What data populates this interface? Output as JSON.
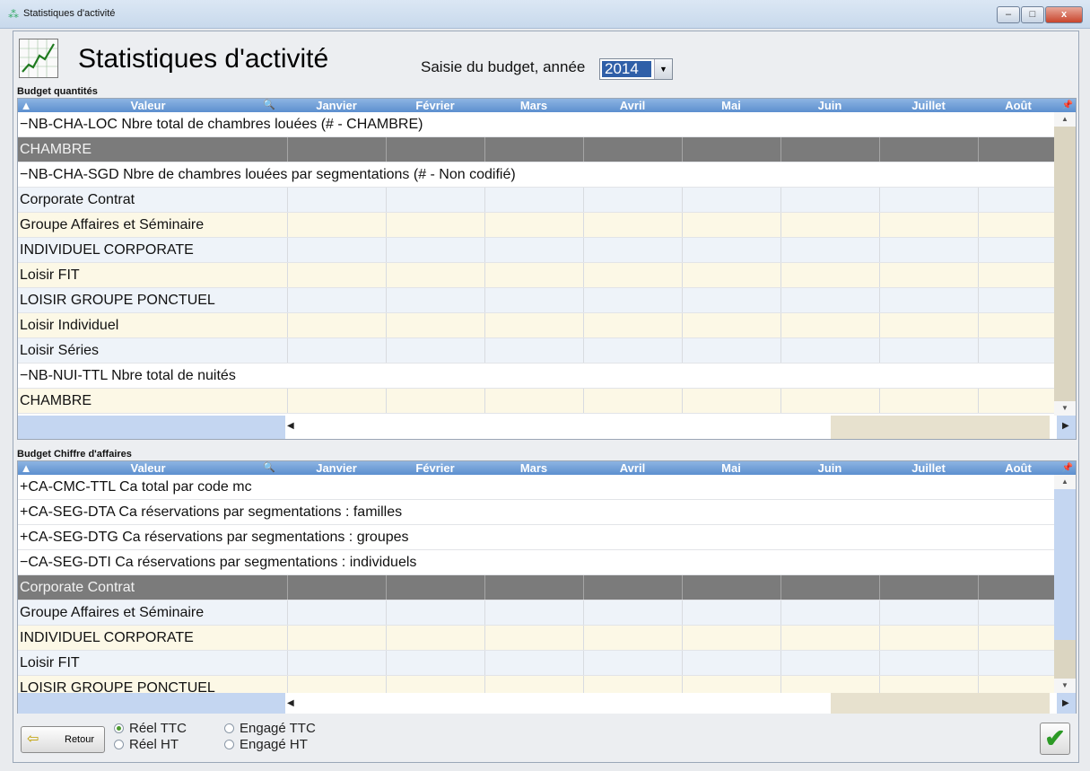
{
  "window": {
    "title": "Statistiques d'activité",
    "minimize": "–",
    "maximize": "□",
    "close": "x"
  },
  "header": {
    "title": "Statistiques d'activité",
    "year_label": "Saisie du budget, année",
    "year_value": "2014"
  },
  "columns": [
    "Valeur",
    "Janvier",
    "Février",
    "Mars",
    "Avril",
    "Mai",
    "Juin",
    "Juillet",
    "Août"
  ],
  "budget_quantites": {
    "title": "Budget quantités",
    "rows": [
      {
        "type": "group",
        "expander": "−",
        "label": "NB-CHA-LOC Nbre total de chambres louées (# - CHAMBRE)"
      },
      {
        "type": "dark",
        "label": "CHAMBRE"
      },
      {
        "type": "group",
        "expander": "−",
        "label": "NB-CHA-SGD Nbre de chambres louées par segmentations (# - Non codifié)"
      },
      {
        "type": "alt",
        "label": "Corporate Contrat"
      },
      {
        "type": "yel",
        "label": "Groupe Affaires et Séminaire"
      },
      {
        "type": "alt",
        "label": "INDIVIDUEL CORPORATE"
      },
      {
        "type": "yel",
        "label": "Loisir FIT"
      },
      {
        "type": "alt",
        "label": "LOISIR GROUPE PONCTUEL"
      },
      {
        "type": "yel",
        "label": "Loisir Individuel"
      },
      {
        "type": "alt",
        "label": "Loisir Séries"
      },
      {
        "type": "group",
        "expander": "−",
        "label": "NB-NUI-TTL Nbre total de nuités"
      },
      {
        "type": "yel",
        "label": "CHAMBRE"
      }
    ]
  },
  "budget_ca": {
    "title": "Budget Chiffre d'affaires",
    "rows": [
      {
        "type": "group",
        "expander": "+",
        "label": "CA-CMC-TTL Ca total par code mc"
      },
      {
        "type": "group",
        "expander": "+",
        "label": "CA-SEG-DTA Ca réservations par segmentations : familles"
      },
      {
        "type": "group",
        "expander": "+",
        "label": "CA-SEG-DTG Ca réservations par segmentations : groupes"
      },
      {
        "type": "group",
        "expander": "−",
        "label": "CA-SEG-DTI Ca réservations par segmentations : individuels"
      },
      {
        "type": "dark",
        "label": "Corporate Contrat"
      },
      {
        "type": "alt",
        "label": "Groupe Affaires et Séminaire"
      },
      {
        "type": "yel",
        "label": "INDIVIDUEL CORPORATE"
      },
      {
        "type": "alt",
        "label": "Loisir FIT"
      },
      {
        "type": "yel",
        "label": "LOISIR GROUPE PONCTUEL"
      }
    ]
  },
  "footer": {
    "retour_label": "Retour",
    "radios": [
      {
        "label": "Réel TTC",
        "checked": true
      },
      {
        "label": "Engagé TTC",
        "checked": false
      },
      {
        "label": "Réel HT",
        "checked": false
      },
      {
        "label": "Engagé HT",
        "checked": false
      }
    ],
    "ok_symbol": "✔"
  },
  "icons": {
    "sort": "▲",
    "search": "🔍",
    "pin": "📌",
    "scroll_up": "▲",
    "scroll_down": "▼",
    "scroll_left": "◀",
    "scroll_right": "▶"
  }
}
